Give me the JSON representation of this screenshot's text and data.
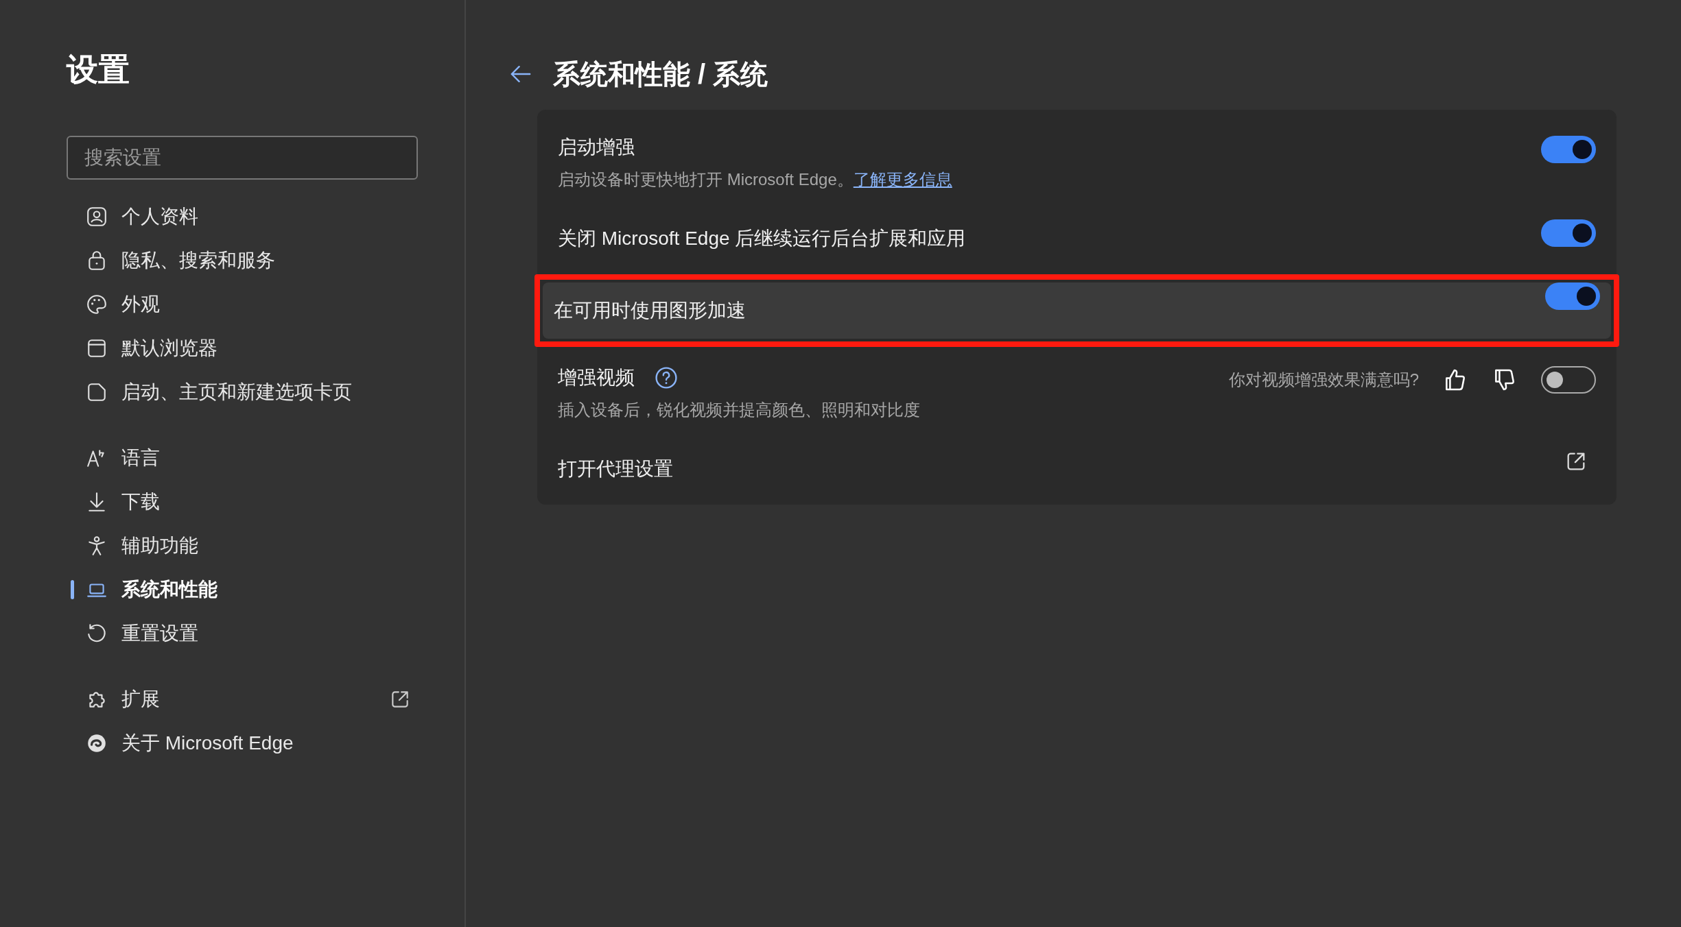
{
  "sidebar": {
    "title": "设置",
    "search": {
      "placeholder": "搜索设置"
    },
    "groups": [
      [
        {
          "label": "个人资料",
          "selected": false,
          "external": false
        },
        {
          "label": "隐私、搜索和服务",
          "selected": false,
          "external": false
        },
        {
          "label": "外观",
          "selected": false,
          "external": false
        },
        {
          "label": "默认浏览器",
          "selected": false,
          "external": false
        },
        {
          "label": "启动、主页和新建选项卡页",
          "selected": false,
          "external": false
        }
      ],
      [
        {
          "label": "语言",
          "selected": false,
          "external": false
        },
        {
          "label": "下载",
          "selected": false,
          "external": false
        },
        {
          "label": "辅助功能",
          "selected": false,
          "external": false
        },
        {
          "label": "系统和性能",
          "selected": true,
          "external": false
        },
        {
          "label": "重置设置",
          "selected": false,
          "external": false
        }
      ],
      [
        {
          "label": "扩展",
          "selected": false,
          "external": true
        },
        {
          "label": "关于 Microsoft Edge",
          "selected": false,
          "external": false
        }
      ]
    ]
  },
  "page": {
    "title": "系统和性能 / 系统",
    "rows": [
      {
        "kind": "toggle",
        "title": "启动增强",
        "description": "启动设备时更快地打开 Microsoft Edge。",
        "link": "了解更多信息",
        "on": true,
        "highlighted": false
      },
      {
        "kind": "toggle",
        "title": "关闭 Microsoft Edge 后继续运行后台扩展和应用",
        "on": true,
        "highlighted": false
      },
      {
        "kind": "toggle",
        "title": "在可用时使用图形加速",
        "on": true,
        "highlighted": true
      },
      {
        "kind": "feedback",
        "title": "增强视频",
        "description": "插入设备后，锐化视频并提高颜色、照明和对比度",
        "question": "你对视频增强效果满意吗?",
        "on": false,
        "highlighted": false
      },
      {
        "kind": "external",
        "title": "打开代理设置",
        "highlighted": false
      }
    ]
  }
}
